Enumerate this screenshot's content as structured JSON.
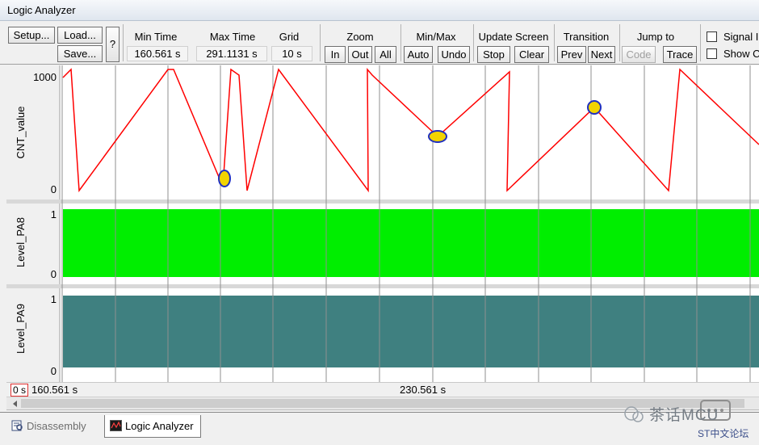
{
  "window": {
    "title": "Logic Analyzer"
  },
  "toolbar": {
    "setup_label": "Setup...",
    "load_label": "Load...",
    "save_label": "Save...",
    "help_label": "?",
    "min_time": {
      "label": "Min Time",
      "value": "160.561 s"
    },
    "max_time": {
      "label": "Max Time",
      "value": "291.1131 s"
    },
    "grid": {
      "label": "Grid",
      "value": "10 s"
    },
    "zoom": {
      "label": "Zoom",
      "in": "In",
      "out": "Out",
      "all": "All"
    },
    "minmax": {
      "label": "Min/Max",
      "auto": "Auto",
      "undo": "Undo"
    },
    "update": {
      "label": "Update Screen",
      "stop": "Stop",
      "clear": "Clear"
    },
    "transition": {
      "label": "Transition",
      "prev": "Prev",
      "next": "Next"
    },
    "jump": {
      "label": "Jump to",
      "code": "Code",
      "trace": "Trace"
    },
    "signal_info": {
      "label": "Signal I",
      "checked": false
    },
    "show_cycles": {
      "label": "Show C",
      "checked": false
    }
  },
  "signals": [
    {
      "name": "CNT_value",
      "max_label": "1000",
      "min_label": "0",
      "color": "#ff0000"
    },
    {
      "name": "Level_PA8",
      "max_label": "1",
      "min_label": "0",
      "color": "#00ee00"
    },
    {
      "name": "Level_PA9",
      "max_label": "1",
      "min_label": "0",
      "color": "#3f8080"
    }
  ],
  "time_axis": {
    "cursor_label": "0 s",
    "start_label": "160.561 s",
    "mid_label": "230.561 s"
  },
  "bottom_tabs": [
    {
      "label": "Disassembly",
      "icon": "disassembly-icon",
      "active": false
    },
    {
      "label": "Logic Analyzer",
      "icon": "logic-analyzer-icon",
      "active": true
    }
  ],
  "watermark": {
    "brand": "茶话MCU",
    "forum": "ST中文论坛"
  }
}
